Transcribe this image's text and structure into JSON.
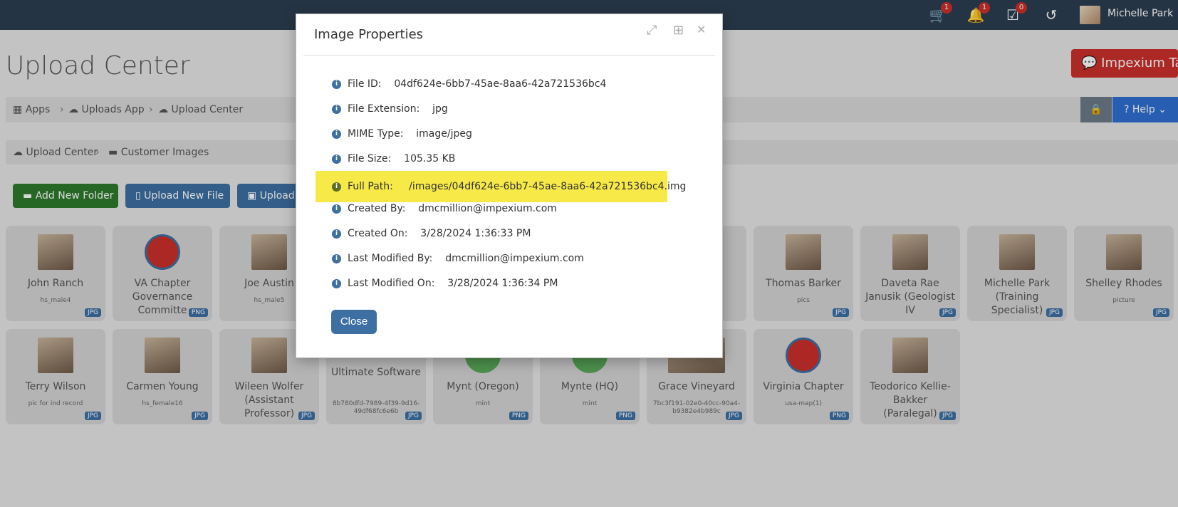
{
  "topbar": {
    "cart_count": "1",
    "notif_count": "1",
    "tasks_count": "0",
    "user_name": "Michelle Park"
  },
  "page": {
    "title": "Upload Center",
    "talk_button": "Impexium Talk",
    "help_label": "Help"
  },
  "breadcrumb": [
    "Apps",
    "Uploads App",
    "Upload Center"
  ],
  "folder_path": [
    "Upload Center",
    "Customer Images"
  ],
  "toolbar": {
    "add_folder": "Add New Folder",
    "upload_file": "Upload New File",
    "upload_image": "Upload"
  },
  "tiles_row1": [
    {
      "name": "John Ranch",
      "sub": "hs_male4",
      "type": "JPG"
    },
    {
      "name": "VA Chapter Governance Committe",
      "sub": "",
      "type": "PNG"
    },
    {
      "name": "Joe Austin",
      "sub": "hs_male5",
      "type": ""
    },
    {
      "name": "Thomas Barker",
      "sub": "pics",
      "type": "JPG"
    },
    {
      "name": "Daveta Rae Janusik (Geologist IV",
      "sub": "",
      "type": "JPG"
    },
    {
      "name": "Michelle Park (Training Specialist)",
      "sub": "",
      "type": "JPG"
    },
    {
      "name": "Shelley Rhodes",
      "sub": "picture",
      "type": "JPG"
    }
  ],
  "tiles_row2": [
    {
      "name": "Terry Wilson",
      "sub": "pic for ind record",
      "type": "JPG"
    },
    {
      "name": "Carmen Young",
      "sub": "hs_female16",
      "type": "JPG"
    },
    {
      "name": "Wileen Wolfer (Assistant Professor)",
      "sub": "",
      "type": "JPG"
    },
    {
      "name": "Ultimate Software",
      "sub": "8b780dfd-7989-4f39-9d16-49df68fc6e6b",
      "type": "JPG"
    },
    {
      "name": "Mynt (Oregon)",
      "sub": "mint",
      "type": "PNG"
    },
    {
      "name": "Mynte (HQ)",
      "sub": "mint",
      "type": "PNG"
    },
    {
      "name": "Grace Vineyard",
      "sub": "7bc3f191-02e0-40cc-90a4-b9382e4b989c",
      "type": "JPG"
    },
    {
      "name": "Virginia Chapter",
      "sub": "usa-map(1)",
      "type": "PNG"
    },
    {
      "name": "Teodorico Kellie-Bakker (Paralegal)",
      "sub": "",
      "type": "JPG"
    }
  ],
  "modal": {
    "title": "Image Properties",
    "props": [
      {
        "label": "File ID:",
        "value": "04df624e-6bb7-45ae-8aa6-42a721536bc4"
      },
      {
        "label": "File Extension:",
        "value": "jpg"
      },
      {
        "label": "MIME Type:",
        "value": "image/jpeg"
      },
      {
        "label": "File Size:",
        "value": "105.35 KB"
      },
      {
        "label": "Full Path:",
        "value": "/images/04df624e-6bb7-45ae-8aa6-42a721536bc4.img"
      },
      {
        "label": "Created By:",
        "value": "dmcmillion@impexium.com"
      },
      {
        "label": "Created On:",
        "value": "3/28/2024 1:36:33 PM"
      },
      {
        "label": "Last Modified By:",
        "value": "dmcmillion@impexium.com"
      },
      {
        "label": "Last Modified On:",
        "value": "3/28/2024 1:36:34 PM"
      }
    ],
    "close_label": "Close",
    "highlight_color": "#f7e948"
  },
  "colors": {
    "topbar": "#2c3e50",
    "primary": "#3d6fa3",
    "success": "#2d7a2d",
    "danger": "#c9302c"
  }
}
